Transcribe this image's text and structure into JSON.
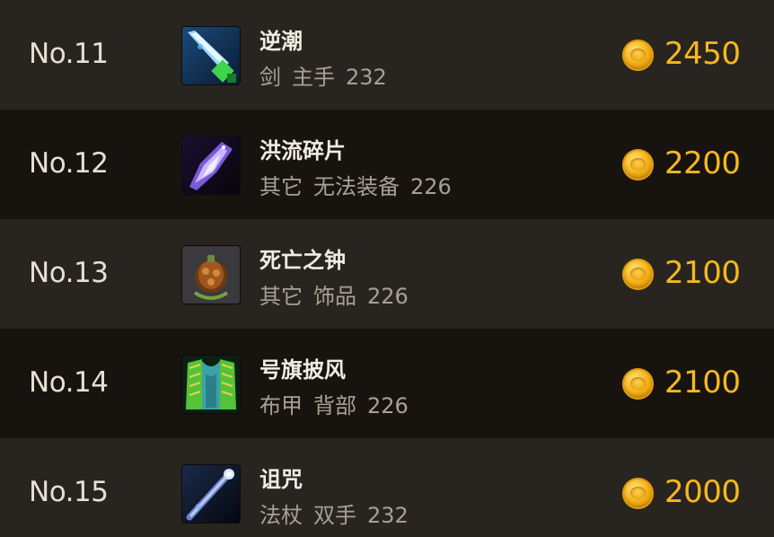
{
  "items": [
    {
      "rank": "No.11",
      "icon": "sword-icon",
      "name": "逆潮",
      "type": "剑",
      "slot": "主手",
      "level": "232",
      "price": "2450"
    },
    {
      "rank": "No.12",
      "icon": "crystal-shard-icon",
      "name": "洪流碎片",
      "type": "其它",
      "slot": "无法装备",
      "level": "226",
      "price": "2200"
    },
    {
      "rank": "No.13",
      "icon": "bell-icon",
      "name": "死亡之钟",
      "type": "其它",
      "slot": "饰品",
      "level": "226",
      "price": "2100"
    },
    {
      "rank": "No.14",
      "icon": "cloak-icon",
      "name": "号旗披风",
      "type": "布甲",
      "slot": "背部",
      "level": "226",
      "price": "2100"
    },
    {
      "rank": "No.15",
      "icon": "staff-icon",
      "name": "诅咒",
      "type": "法杖",
      "slot": "双手",
      "level": "232",
      "price": "2000"
    }
  ]
}
